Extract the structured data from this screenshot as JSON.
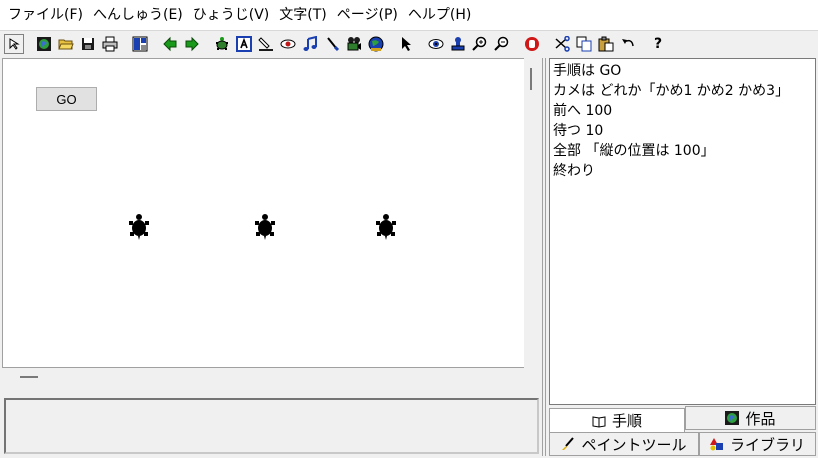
{
  "menu": [
    "ファイル(F)",
    "へんしゅう(E)",
    "ひょうじ(V)",
    "文字(T)",
    "ページ(P)",
    "ヘルプ(H)"
  ],
  "toolbar": {
    "icons": [
      "pointer-small-icon",
      "globe-icon",
      "open-folder-icon",
      "save-icon",
      "print-icon",
      "panels-icon",
      "arrow-left-icon",
      "arrow-right-icon",
      "turtle-icon",
      "text-a-icon",
      "pen-icon",
      "eye-icon",
      "music-note-icon",
      "brush-icon",
      "camera-icon",
      "earth-icon",
      "cursor-icon",
      "view-icon",
      "stamp-icon",
      "zoom-in-icon",
      "zoom-out-icon",
      "stop-icon",
      "cut-icon",
      "copy-icon",
      "paste-icon",
      "undo-icon",
      "help-icon"
    ],
    "help_label": "?"
  },
  "stage": {
    "go_button": "GO"
  },
  "program": {
    "lines": [
      "手順は GO",
      "カメは どれか「かめ1 かめ2 かめ3」",
      "前へ 100",
      "待つ 10",
      "全部 「縦の位置は 100」",
      "終わり"
    ]
  },
  "tabs": {
    "program": "手順",
    "works": "作品",
    "paint": "ペイントツール",
    "library": "ライブラリ"
  },
  "colors": {
    "turtle": "#000000",
    "stop": "#d01818",
    "arrow": "#1a9a1a",
    "accent_blue": "#1a3fb0"
  }
}
